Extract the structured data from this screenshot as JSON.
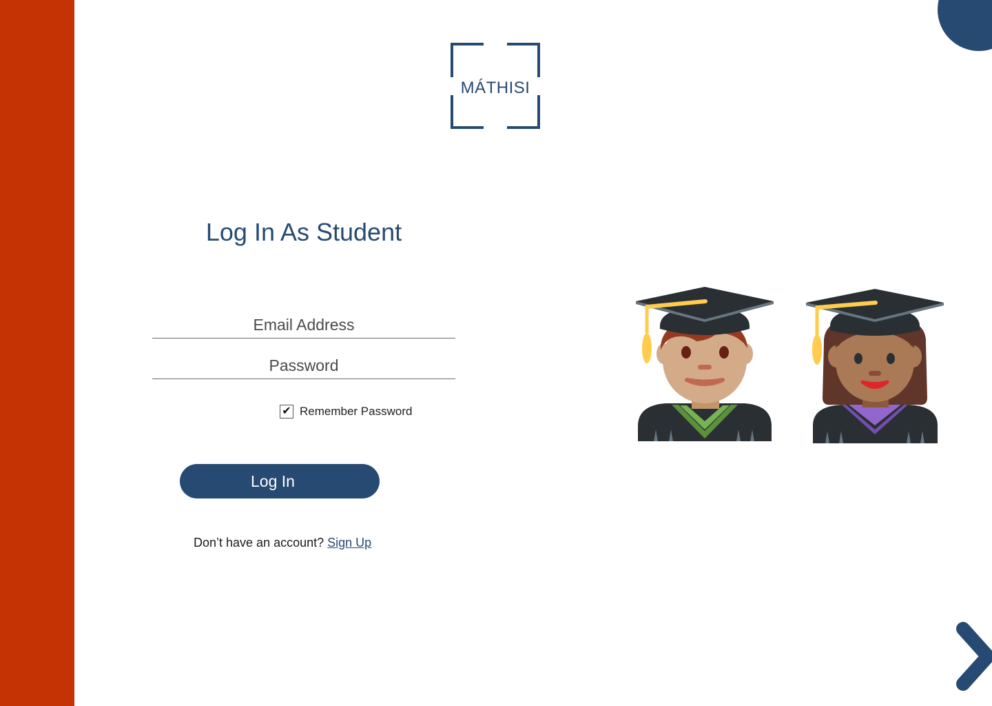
{
  "brand": {
    "logo_text": "MÁTHISI",
    "primary_color": "#274a72",
    "accent_color": "#c53304"
  },
  "login": {
    "title": "Log In As Student",
    "email_placeholder": "Email Address",
    "password_placeholder": "Password",
    "remember_label": "Remember Password",
    "remember_checked": true,
    "submit_label": "Log In"
  },
  "signup": {
    "prompt": "Don’t have an account?",
    "link_label": "Sign Up"
  },
  "illustrations": {
    "left_icon": "man-student-icon",
    "right_icon": "woman-student-icon"
  },
  "navigation": {
    "next_icon": "chevron-right-icon"
  }
}
